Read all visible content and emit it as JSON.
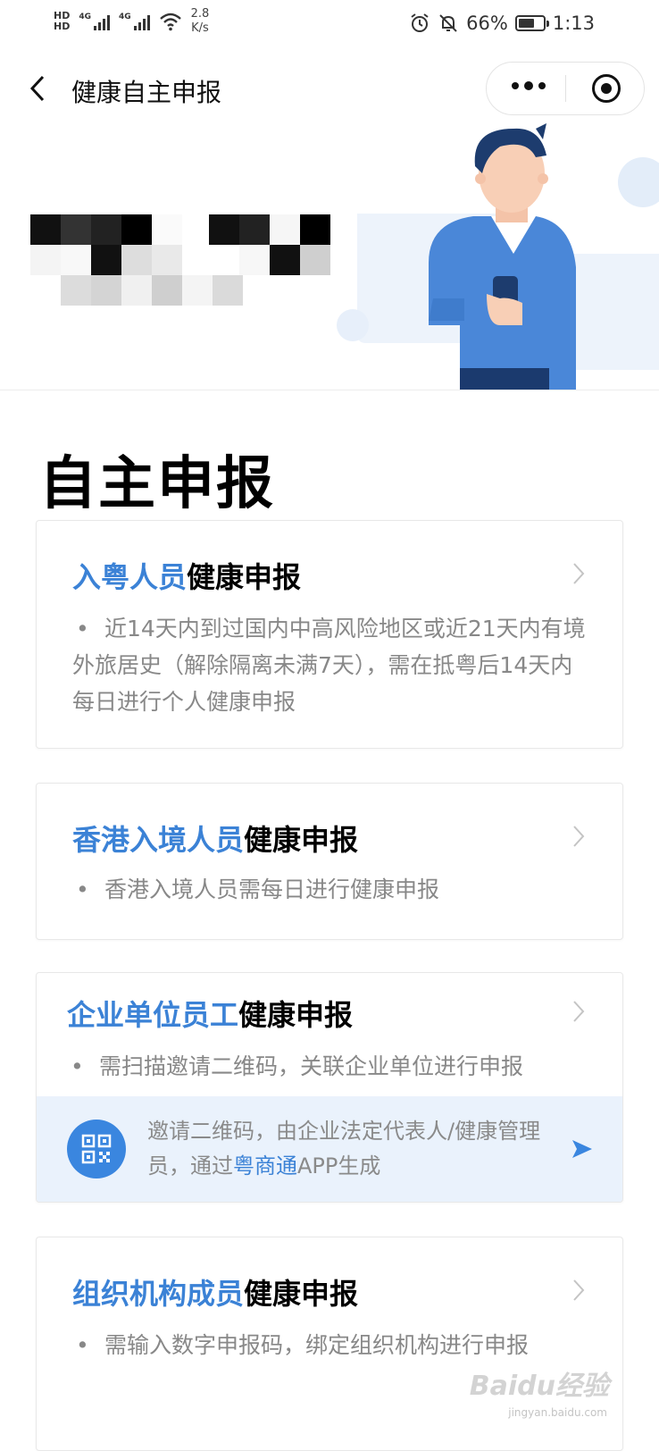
{
  "status_bar": {
    "hd1": "HD",
    "hd2": "HD",
    "net1": "4G",
    "net2": "4G",
    "speed_value": "2.8",
    "speed_unit": "K/s",
    "battery_percent": "66%",
    "battery_level": 0.66,
    "time": "1:13"
  },
  "nav": {
    "title": "健康自主申报"
  },
  "page": {
    "title": "自主申报"
  },
  "cards": [
    {
      "title_highlight": "入粤人员",
      "title_rest": "健康申报",
      "bullet": "•",
      "desc": "近14天内到过国内中高风险地区或近21天内有境外旅居史（解除隔离未满7天），需在抵粤后14天内每日进行个人健康申报"
    },
    {
      "title_highlight": "香港入境人员",
      "title_rest": "健康申报",
      "bullet": "•",
      "desc": "香港入境人员需每日进行健康申报"
    },
    {
      "title_highlight": "企业单位员工",
      "title_rest": "健康申报",
      "bullet": "•",
      "desc": "需扫描邀请二维码，关联企业单位进行申报",
      "qr_note_before": "邀请二维码，由企业法定代表人/健康管理员，通过",
      "qr_note_link": "粤商通",
      "qr_note_after": "APP生成"
    },
    {
      "title_highlight": "组织机构成员",
      "title_rest": "健康申报",
      "bullet": "•",
      "desc": "需输入数字申报码，绑定组织机构进行申报"
    }
  ],
  "watermark": {
    "text": "Baidu经验",
    "sub": "jingyan.baidu.com"
  },
  "colors": {
    "accent_blue": "#3b82d6",
    "qr_panel_bg": "#eaf2fc",
    "qr_icon_bg": "#3a86df",
    "desc_gray": "#888888"
  },
  "icons": [
    "back-arrow-icon",
    "more-dots-icon",
    "close-target-icon",
    "chevron-right-icon",
    "qr-code-icon",
    "send-arrow-icon",
    "alarm-icon",
    "mute-bell-icon",
    "wifi-icon",
    "battery-icon"
  ]
}
